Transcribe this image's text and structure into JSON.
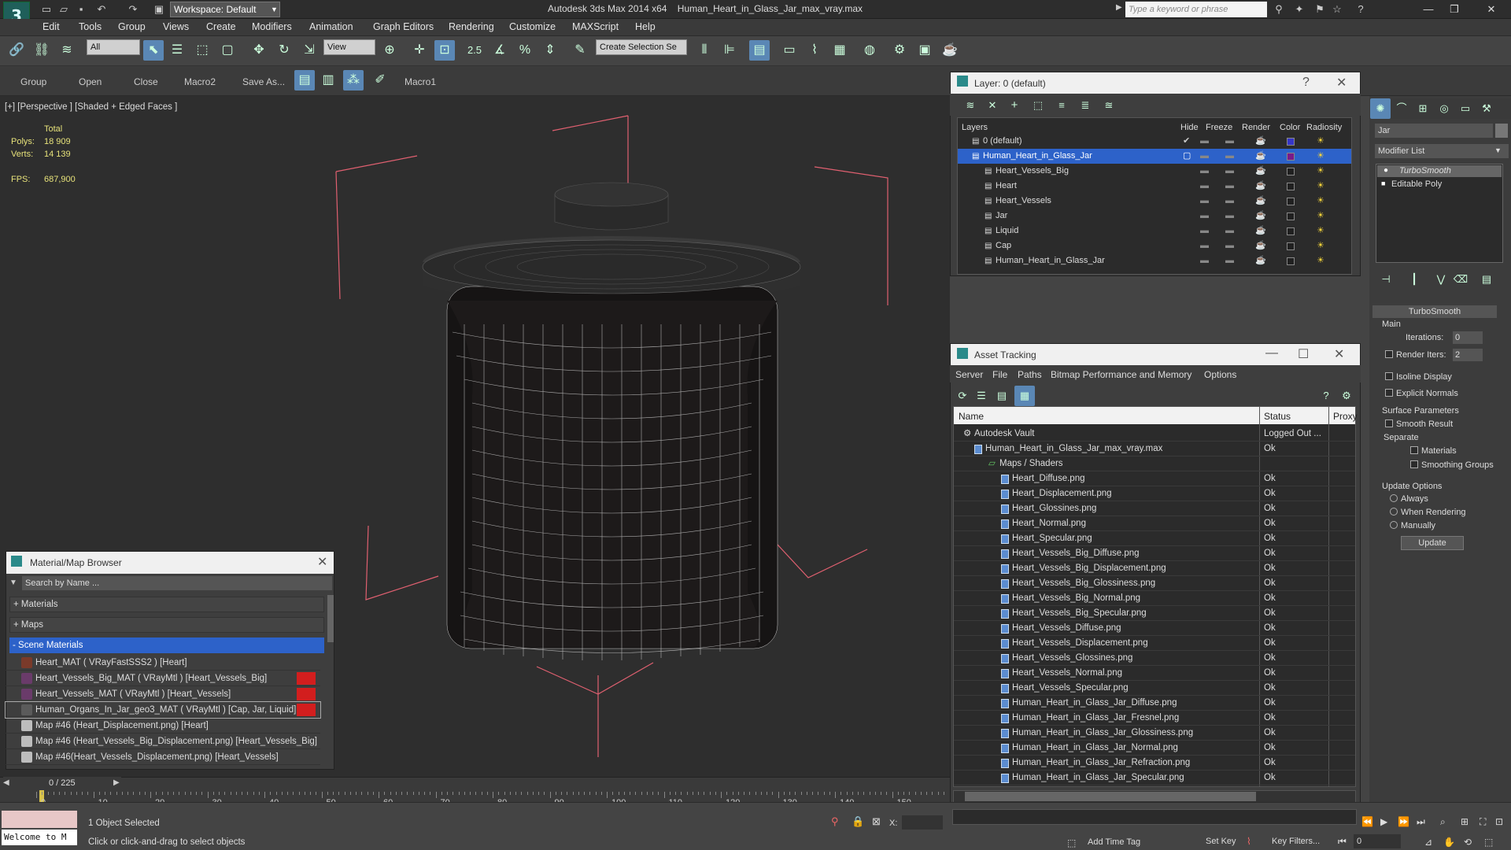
{
  "title": {
    "app": "Autodesk 3ds Max  2014 x64",
    "file": "Human_Heart_in_Glass_Jar_max_vray.max",
    "workspace": "Workspace: Default",
    "search_placeholder": "Type a keyword or phrase"
  },
  "menu": [
    "Edit",
    "Tools",
    "Group",
    "Views",
    "Create",
    "Modifiers",
    "Animation",
    "Graph Editors",
    "Rendering",
    "Customize",
    "MAXScript",
    "Help"
  ],
  "toolbar": {
    "filter": "All",
    "refcoord": "View",
    "selset": "Create Selection Se",
    "snap_val": "2.5"
  },
  "toolbar2": [
    "Group",
    "Open",
    "Close",
    "Macro2",
    "Save As...",
    "Macro1"
  ],
  "viewport": {
    "label": "[+] [Perspective ] [Shaded + Edged Faces ]",
    "total": "Total",
    "polys_label": "Polys:",
    "polys": "18 909",
    "verts_label": "Verts:",
    "verts": "14 139",
    "fps_label": "FPS:",
    "fps": "687,900"
  },
  "layer_window": {
    "title": "Layer: 0 (default)",
    "columns": [
      "Layers",
      "Hide",
      "Freeze",
      "Render",
      "Color",
      "Radiosity"
    ],
    "rows": [
      {
        "name": "0 (default)",
        "color": "#3636c8"
      },
      {
        "name": "Human_Heart_in_Glass_Jar",
        "color": "#7a1a8a"
      },
      {
        "name": "Heart_Vessels_Big",
        "color": "#202020"
      },
      {
        "name": "Heart",
        "color": "#202020"
      },
      {
        "name": "Heart_Vessels",
        "color": "#202020"
      },
      {
        "name": "Jar",
        "color": "#202020"
      },
      {
        "name": "Liquid",
        "color": "#202020"
      },
      {
        "name": "Cap",
        "color": "#202020"
      },
      {
        "name": "Human_Heart_in_Glass_Jar",
        "color": "#202020"
      }
    ]
  },
  "asset_window": {
    "title": "Asset Tracking",
    "menu": [
      "Server",
      "File",
      "Paths",
      "Bitmap Performance and Memory",
      "Options"
    ],
    "columns": [
      "Name",
      "Status",
      "Proxy"
    ],
    "rows": [
      {
        "name": "Autodesk Vault",
        "status": "Logged Out ..."
      },
      {
        "name": "Human_Heart_in_Glass_Jar_max_vray.max",
        "status": "Ok"
      },
      {
        "name": "Maps / Shaders",
        "status": ""
      },
      {
        "name": "Heart_Diffuse.png",
        "status": "Ok"
      },
      {
        "name": "Heart_Displacement.png",
        "status": "Ok"
      },
      {
        "name": "Heart_Glossines.png",
        "status": "Ok"
      },
      {
        "name": "Heart_Normal.png",
        "status": "Ok"
      },
      {
        "name": "Heart_Specular.png",
        "status": "Ok"
      },
      {
        "name": "Heart_Vessels_Big_Diffuse.png",
        "status": "Ok"
      },
      {
        "name": "Heart_Vessels_Big_Displacement.png",
        "status": "Ok"
      },
      {
        "name": "Heart_Vessels_Big_Glossiness.png",
        "status": "Ok"
      },
      {
        "name": "Heart_Vessels_Big_Normal.png",
        "status": "Ok"
      },
      {
        "name": "Heart_Vessels_Big_Specular.png",
        "status": "Ok"
      },
      {
        "name": "Heart_Vessels_Diffuse.png",
        "status": "Ok"
      },
      {
        "name": "Heart_Vessels_Displacement.png",
        "status": "Ok"
      },
      {
        "name": "Heart_Vessels_Glossines.png",
        "status": "Ok"
      },
      {
        "name": "Heart_Vessels_Normal.png",
        "status": "Ok"
      },
      {
        "name": "Heart_Vessels_Specular.png",
        "status": "Ok"
      },
      {
        "name": "Human_Heart_in_Glass_Jar_Diffuse.png",
        "status": "Ok"
      },
      {
        "name": "Human_Heart_in_Glass_Jar_Fresnel.png",
        "status": "Ok"
      },
      {
        "name": "Human_Heart_in_Glass_Jar_Glossiness.png",
        "status": "Ok"
      },
      {
        "name": "Human_Heart_in_Glass_Jar_Normal.png",
        "status": "Ok"
      },
      {
        "name": "Human_Heart_in_Glass_Jar_Refraction.png",
        "status": "Ok"
      },
      {
        "name": "Human_Heart_in_Glass_Jar_Specular.png",
        "status": "Ok"
      }
    ]
  },
  "material_browser": {
    "title": "Material/Map Browser",
    "search": "Search by Name ...",
    "groups": [
      "+ Materials",
      "+ Maps",
      "- Scene Materials"
    ],
    "items": [
      {
        "label": "Heart_MAT  ( VRayFastSSS2 )  [Heart]",
        "swatch": "#7a3a2a"
      },
      {
        "label": "Heart_Vessels_Big_MAT ( VRayMtl ) [Heart_Vessels_Big]",
        "swatch": "#6a3b6a"
      },
      {
        "label": "Heart_Vessels_MAT  ( VRayMtl ) [Heart_Vessels]",
        "swatch": "#6a3b6a"
      },
      {
        "label": "Human_Organs_In_Jar_geo3_MAT  ( VRayMtl ) [Cap, Jar, Liquid]",
        "swatch": "#5b5b5b"
      },
      {
        "label": "Map #46 (Heart_Displacement.png)  [Heart]",
        "swatch": "#bdbdbd"
      },
      {
        "label": "Map #46 (Heart_Vessels_Big_Displacement.png) [Heart_Vessels_Big]",
        "swatch": "#bdbdbd"
      },
      {
        "label": "Map #46(Heart_Vessels_Displacement.png) [Heart_Vessels]",
        "swatch": "#bdbdbd"
      }
    ]
  },
  "command_panel": {
    "object_name": "Jar",
    "modifier_list": "Modifier List",
    "stack": [
      "TurboSmooth",
      "Editable Poly"
    ],
    "rollout": "TurboSmooth",
    "main": "Main",
    "iterations_label": "Iterations:",
    "iterations": "0",
    "render_iters_label": "Render Iters:",
    "render_iters": "2",
    "isoline": "Isoline Display",
    "explicit": "Explicit Normals",
    "surface": "Surface Parameters",
    "smooth": "Smooth Result",
    "separate": "Separate",
    "materials": "Materials",
    "smoothing": "Smoothing Groups",
    "update_options": "Update Options",
    "always": "Always",
    "when_rendering": "When Rendering",
    "manually": "Manually",
    "update": "Update"
  },
  "timeline": {
    "frame": "0 / 225",
    "ticks": [
      "0",
      "10",
      "20",
      "30",
      "40",
      "50",
      "60",
      "70",
      "80",
      "90",
      "100",
      "110",
      "120",
      "130",
      "140",
      "150"
    ]
  },
  "status": {
    "welcome": "Welcome to M",
    "selected": "1 Object Selected",
    "prompt": "Click or click-and-drag to select objects",
    "x_label": "X:",
    "add_time_tag": "Add Time Tag",
    "set_key": "Set Key",
    "key_filters": "Key Filters...",
    "frame_field": "0"
  }
}
